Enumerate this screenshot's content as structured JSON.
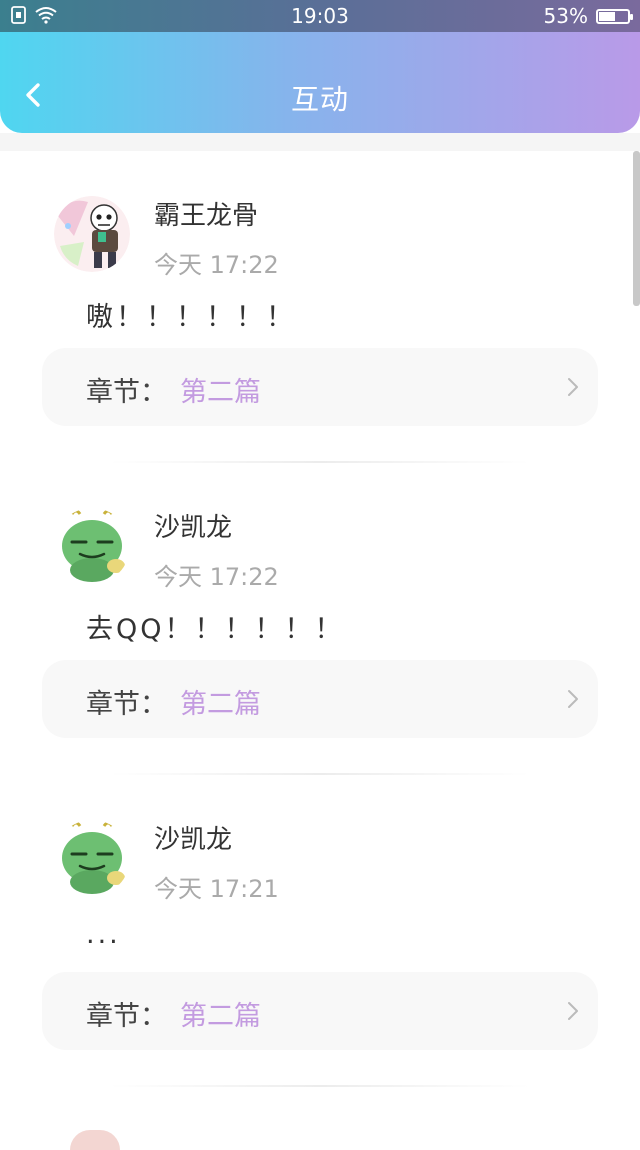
{
  "status_bar": {
    "time": "19:03",
    "battery": "53%",
    "battery_level": 0.53,
    "icons": [
      "sim-icon",
      "wifi-icon"
    ]
  },
  "header": {
    "title": "互动",
    "back_icon": "chevron-left-icon",
    "gradient": [
      "#4fd6f0",
      "#b99ae8"
    ]
  },
  "colors": {
    "accent": "#c39be0",
    "muted": "#aaaaaa"
  },
  "comments": [
    {
      "username": "霸王龙骨",
      "time": "今天 17:22",
      "content": "嗷！！！！！！",
      "chapter_label": "章节：",
      "chapter_name": "第二篇",
      "avatar": "skeleton-character-avatar"
    },
    {
      "username": "沙凯龙",
      "time": "今天 17:22",
      "content": "去QQ！！！！！！",
      "chapter_label": "章节：",
      "chapter_name": "第二篇",
      "avatar": "green-dragon-avatar"
    },
    {
      "username": "沙凯龙",
      "time": "今天 17:21",
      "content": "...",
      "chapter_label": "章节：",
      "chapter_name": "第二篇",
      "avatar": "green-dragon-avatar"
    }
  ]
}
